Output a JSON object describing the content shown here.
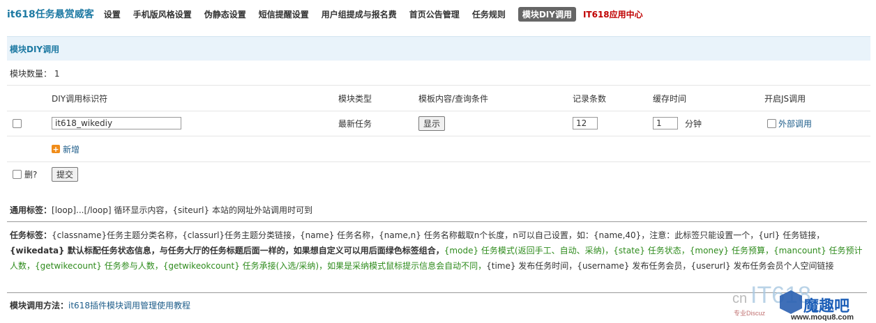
{
  "brand": "it618任务悬赏威客",
  "nav": [
    "设置",
    "手机版风格设置",
    "伪静态设置",
    "短信提醒设置",
    "用户组提成与报名费",
    "首页公告管理",
    "任务规则",
    "模块DIY调用",
    "IT618应用中心"
  ],
  "section_title": "模块DIY调用",
  "count_label": "模块数量：",
  "count_value": "1",
  "headers": {
    "id": "DIY调用标识符",
    "type": "模块类型",
    "template": "模板内容/查询条件",
    "records": "记录条数",
    "cache": "缓存时间",
    "js": "开启JS调用"
  },
  "row": {
    "id_value": "it618_wikediy",
    "type": "最新任务",
    "show_button": "显示",
    "records": "12",
    "cache": "1",
    "cache_unit": "分钟",
    "external": "外部调用"
  },
  "add_label": "新增",
  "delete_label": "删?",
  "submit_label": "提交",
  "general_tags": {
    "label": "通用标签：",
    "text": "[loop]...[/loop] 循环显示内容，{siteurl} 本站的网址外站调用时可到"
  },
  "task_tags": {
    "label": "任务标签：",
    "t1": "{classname}任务主题分类名称，{classurl}任务主题分类链接，{name} 任务名称，{name,n} 任务名称截取n个长度，n可以自己设置，如：{name,40}，注意：此标签只能设置一个，{url} 任务链接，",
    "t2": "{wikedata} 默认标配任务状态信息，与任务大厅的任务标题后面一样的，如果想自定义可以用后面绿色标签组合，",
    "t3": "{mode} 任务模式(返回手工、自动、采纳)，{state} 任务状态，{money} 任务预算，{mancount} 任务预计人数，{getwikecount} 任务参与人数，{getwikeokcount} 任务承接(入选/采纳)，如果是采纳模式鼠标提示信息会自动不同，",
    "t4": "{time} 发布任务时间，{username} 发布任务会员，{userurl} 发布任务会员个人空间链接"
  },
  "method": {
    "label": "模块调用方法：",
    "link": "it618插件模块调用管理使用教程"
  },
  "watermark": {
    "cn": "cn",
    "it": "IT618",
    "brand": "魔趣吧",
    "site": "www.moqu8.com",
    "tag": "专业Discuz"
  }
}
